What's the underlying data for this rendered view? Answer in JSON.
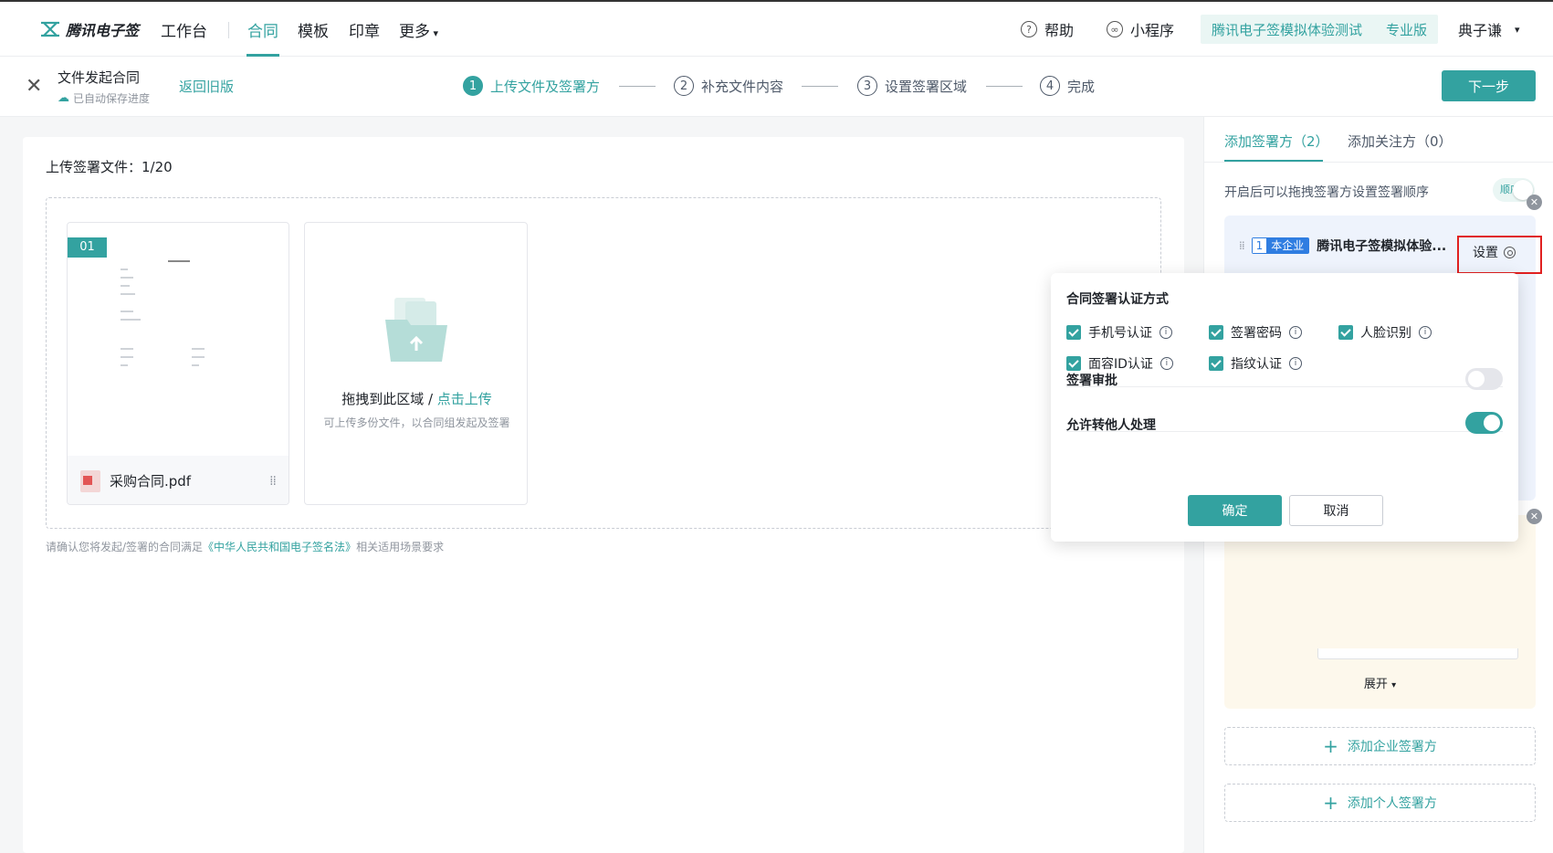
{
  "nav": {
    "logo": "腾讯电子签",
    "items": [
      "工作台",
      "合同",
      "模板",
      "印章",
      "更多"
    ],
    "more_chevron": "chevron-down-icon",
    "help": "帮助",
    "miniprogram": "小程序",
    "org_name": "腾讯电子签模拟体验测试",
    "edition": "专业版",
    "user": "典子谦"
  },
  "stepsbar": {
    "doc_title": "文件发起合同",
    "autosave": "已自动保存进度",
    "back_old": "返回旧版",
    "steps": [
      {
        "num": "1",
        "label": "上传文件及签署方"
      },
      {
        "num": "2",
        "label": "补充文件内容"
      },
      {
        "num": "3",
        "label": "设置签署区域"
      },
      {
        "num": "4",
        "label": "完成"
      }
    ],
    "next": "下一步"
  },
  "main": {
    "upload_title": "上传签署文件：1/20",
    "file": {
      "num": "01",
      "name": "采购合同.pdf"
    },
    "upload_main": "拖拽到此区域 / ",
    "upload_link": "点击上传",
    "upload_sub": "可上传多份文件，以合同组发起及签署",
    "law_prefix": "请确认您将发起/签署的合同满足",
    "law_link": "《中华人民共和国电子签名法》",
    "law_suffix": "相关适用场景要求"
  },
  "rpanel": {
    "tab_signers": "添加签署方（2）",
    "tab_watchers": "添加关注方（0）",
    "order_hint": "开启后可以拖拽签署方设置签署顺序",
    "order_toggle": "顺序签",
    "signer1": {
      "num": "1",
      "tag": "本企业",
      "name": "腾讯电子签模拟体验...",
      "setting": "设置"
    },
    "expand": "展开",
    "add_company": "添加企业签署方",
    "add_person": "添加个人签署方"
  },
  "popover": {
    "title": "合同签署认证方式",
    "options": [
      "手机号认证",
      "签署密码",
      "人脸识别",
      "面容ID认证",
      "指纹认证"
    ],
    "approval": "签署审批",
    "approval_on": false,
    "transfer": "允许转他人处理",
    "transfer_on": true,
    "ok": "确定",
    "cancel": "取消"
  },
  "colors": {
    "accent": "#33a2a0",
    "company_tag": "#2f7de1",
    "highlight": "#e02020"
  }
}
